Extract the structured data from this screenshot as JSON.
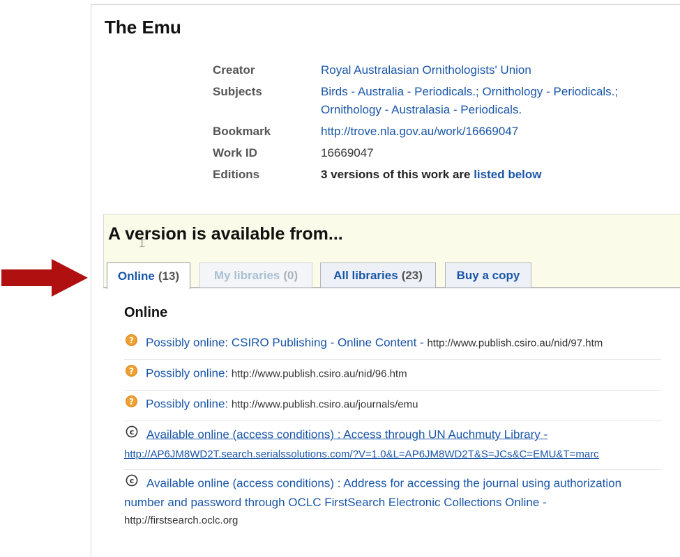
{
  "record": {
    "title": "The Emu",
    "creator_label": "Creator",
    "creator_value": "Royal Australasian Ornithologists' Union",
    "subjects_label": "Subjects",
    "subjects": [
      "Birds - Australia - Periodicals.",
      "Ornithology - Periodicals.",
      "Ornithology - Australasia - Periodicals."
    ],
    "subjects_sep": "; ",
    "bookmark_label": "Bookmark",
    "bookmark_value": "http://trove.nla.gov.au/work/16669047",
    "workid_label": "Work ID",
    "workid_value": "16669047",
    "editions_label": "Editions",
    "editions_text": "3 versions of this work are",
    "editions_link": "listed below"
  },
  "availability": {
    "title": "A version is available from...",
    "tabs": [
      {
        "label": "Online",
        "count": "(13)",
        "state": "active"
      },
      {
        "label": "My libraries",
        "count": "(0)",
        "state": "disabled"
      },
      {
        "label": "All libraries",
        "count": "(23)",
        "state": "normal"
      },
      {
        "label": "Buy a copy",
        "count": "",
        "state": "normal"
      }
    ]
  },
  "online": {
    "heading": "Online",
    "items": [
      {
        "icon": "question-icon",
        "text": "Possibly online: CSIRO Publishing - Online Content - ",
        "url": "http://www.publish.csiro.au/nid/97.htm"
      },
      {
        "icon": "question-icon",
        "text": "Possibly online: ",
        "url": "http://www.publish.csiro.au/nid/96.htm"
      },
      {
        "icon": "question-icon",
        "text": "Possibly online: ",
        "url": "http://www.publish.csiro.au/journals/emu"
      },
      {
        "icon": "copyright-icon",
        "text": "Available online (access conditions) : Access through UN Auchmuty Library - ",
        "url": "http://AP6JM8WD2T.search.serialssolutions.com/?V=1.0&L=AP6JM8WD2T&S=JCs&C=EMU&T=marc"
      },
      {
        "icon": "copyright-icon",
        "text": "Available online (access conditions) : Address for accessing the journal using authorization number and password through OCLC FirstSearch Electronic Collections Online - ",
        "url": "http://firstsearch.oclc.org"
      }
    ]
  },
  "colors": {
    "arrow": "#b01010",
    "link": "#1a56a8",
    "availability_bg": "#fafbe8",
    "question_icon": "#f0a030"
  },
  "annotation": {
    "arrow_icon": "right-arrow-icon"
  }
}
